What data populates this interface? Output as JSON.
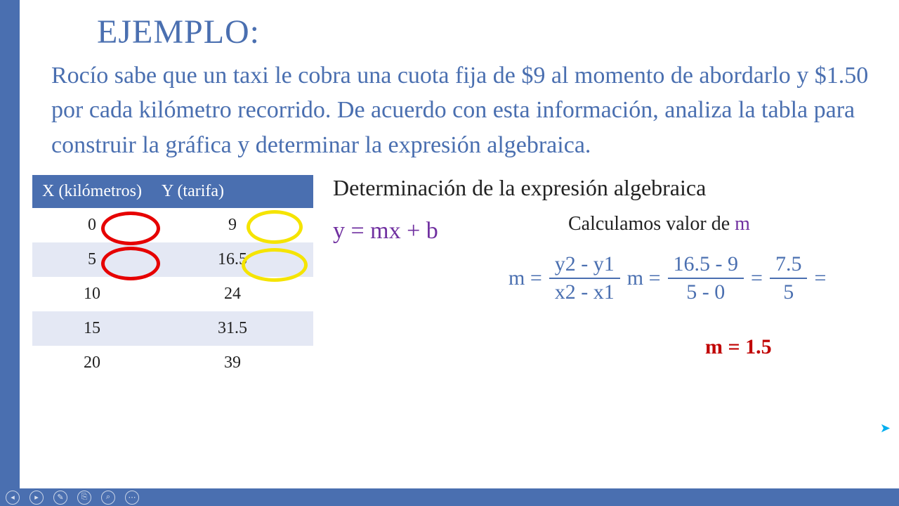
{
  "title": "EJEMPLO:",
  "problem": "Rocío sabe que un taxi le cobra una cuota fija de $9 al momento de abordarlo y $1.50 por cada kilómetro recorrido. De acuerdo con esta información, analiza la tabla para construir la gráfica y determinar la expresión algebraica.",
  "table": {
    "headers": [
      "X (kilómetros)",
      "Y (tarifa)"
    ],
    "rows": [
      [
        "0",
        "9"
      ],
      [
        "5",
        "16.5"
      ],
      [
        "10",
        "24"
      ],
      [
        "15",
        "31.5"
      ],
      [
        "20",
        "39"
      ]
    ]
  },
  "math": {
    "heading": "Determinación de la expresión algebraica",
    "equation": "y = mx + b",
    "calc_label_prefix": "Calculamos valor de ",
    "calc_label_var": "m",
    "m_eq": "m =",
    "frac1_top": "y2  -  y1",
    "frac1_bot": "x2  -  x1",
    "frac2_top": "16.5 - 9",
    "frac2_bot": "5 -   0",
    "frac3_top": "7.5",
    "frac3_bot": "5",
    "eq_sign": "=",
    "result": "m = 1.5"
  },
  "toolbar": {
    "prev": "◂",
    "next": "▸",
    "pen": "✎",
    "copy": "⎘",
    "zoom": "⌕",
    "more": "⋯"
  }
}
